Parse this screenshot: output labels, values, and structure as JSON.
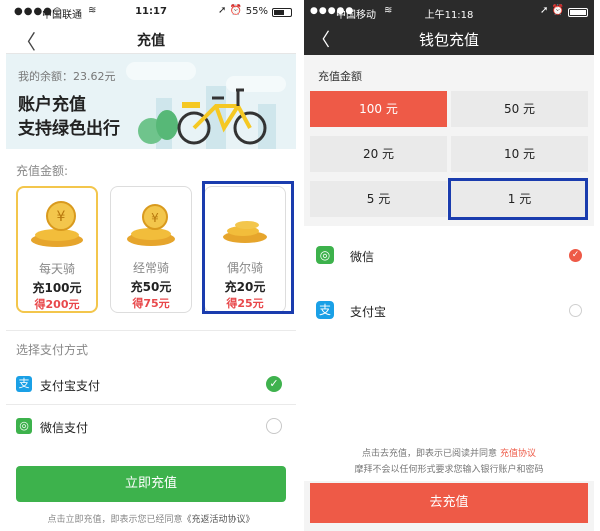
{
  "left": {
    "status": {
      "carrier": "中国联通",
      "time": "11:17",
      "battery": "55%"
    },
    "nav": {
      "back_icon": "chevron-left-icon",
      "title": "充值"
    },
    "banner": {
      "balance": "我的余额：23.62元",
      "headline1": "账户充值",
      "headline2": "支持绿色出行"
    },
    "amount_label": "充值金额:",
    "cards": [
      {
        "name": "每天骑",
        "amount": "充100元",
        "gift": "得200元"
      },
      {
        "name": "经常骑",
        "amount": "充50元",
        "gift": "得75元"
      },
      {
        "name": "偶尔骑",
        "amount": "充20元",
        "gift": "得25元"
      }
    ],
    "pay_label": "选择支付方式",
    "pay_methods": [
      {
        "label": "支付宝支付",
        "icon": "alipay-icon"
      },
      {
        "label": "微信支付",
        "icon": "wechat-icon"
      }
    ],
    "submit": "立即充值",
    "footer_prefix": "点击立即充值，即表示您已经同意",
    "footer_link": "《充返活动协议》"
  },
  "right": {
    "status": {
      "carrier": "中国移动",
      "time": "上午11:18"
    },
    "nav": {
      "back_icon": "chevron-left-icon",
      "title": "钱包充值"
    },
    "amount_label": "充值金额",
    "amounts": [
      "100 元",
      "50 元",
      "20 元",
      "10 元",
      "5 元",
      "1 元"
    ],
    "pay_methods": [
      {
        "label": "微信",
        "icon": "wechat-icon"
      },
      {
        "label": "支付宝",
        "icon": "alipay-icon"
      }
    ],
    "note1_prefix": "点击去充值，即表示已阅读并同意",
    "note1_link": "充值协议",
    "note2": "摩拜不会以任何形式要求您输入银行账户和密码",
    "submit": "去充值"
  },
  "colors": {
    "green": "#3db24c",
    "mobike_red": "#ee5a47",
    "gold": "#f3c64c",
    "highlight_blue": "#1a3cae"
  }
}
